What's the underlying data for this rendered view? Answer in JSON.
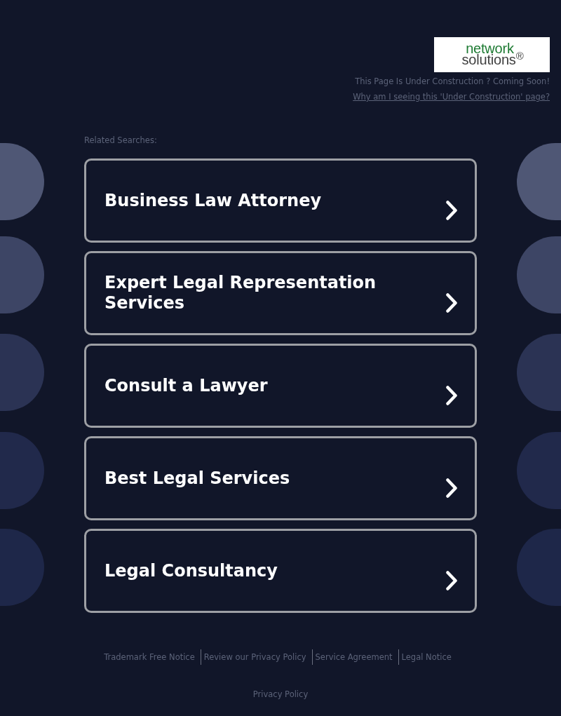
{
  "header": {
    "logo": {
      "line_1": "network",
      "line_2": "solutions$^{®}$"
    },
    "notice": "This Page Is Under Construction ? Coming Soon!",
    "help_link": "Why am I seeing this 'Under Construction' page?"
  },
  "related_searches": {
    "heading": "Related Searches:",
    "items": [
      "Business Law Attorney",
      "Expert Legal Representation Services",
      "Consult a Lawyer",
      "Best Legal Services",
      "Legal Consultancy"
    ]
  },
  "footer": {
    "links": [
      "Trademark Free Notice",
      "Review our Privacy Policy",
      "Service Agreement",
      "Legal Notice"
    ],
    "privacy_link": "Privacy Policy"
  }
}
